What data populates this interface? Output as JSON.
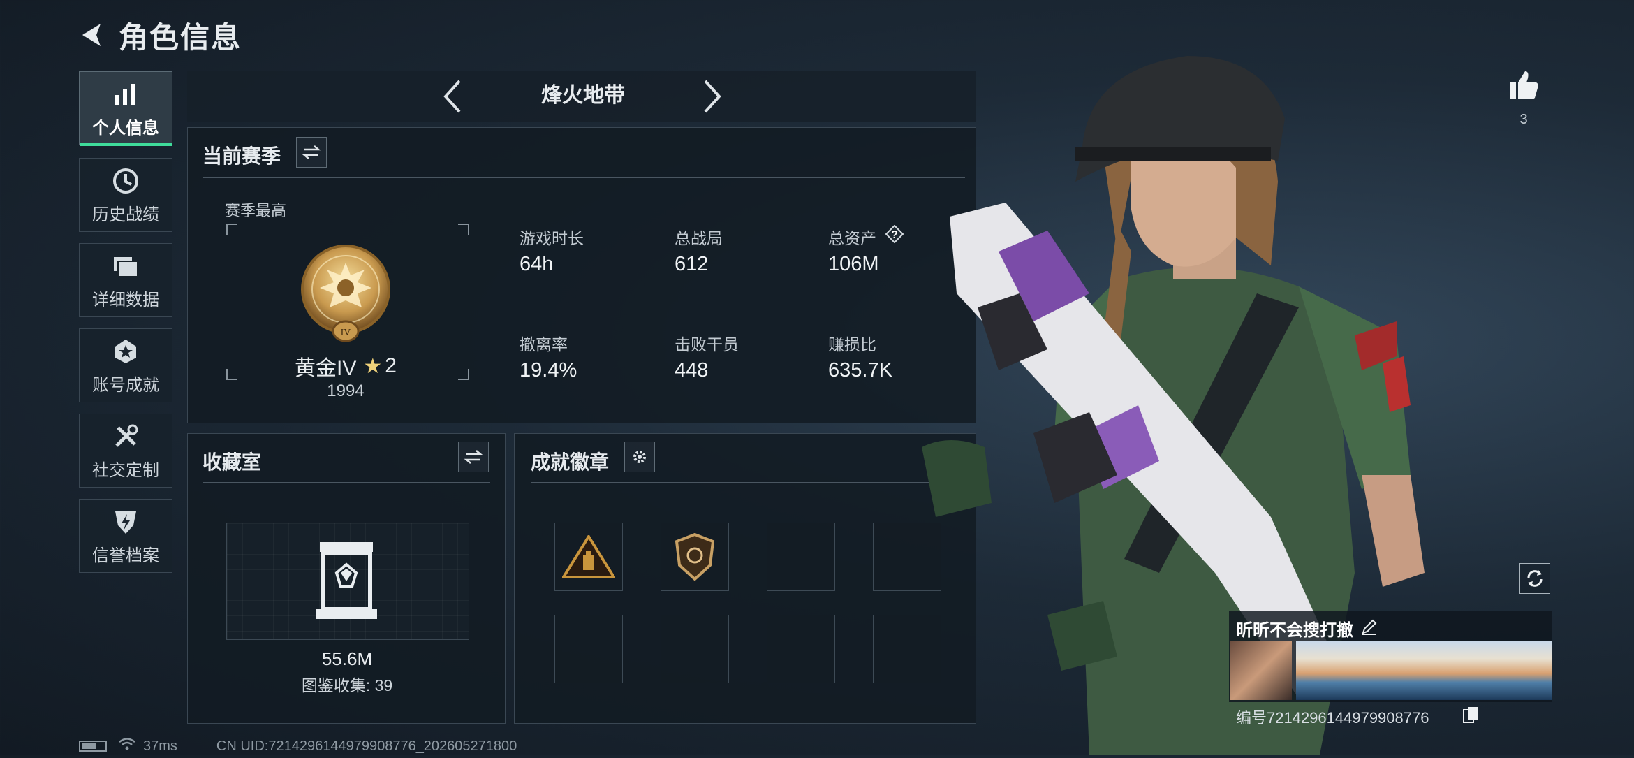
{
  "header": {
    "title": "角色信息"
  },
  "sidebar": {
    "items": [
      {
        "label": "个人信息",
        "icon": "bar-chart-icon",
        "active": true
      },
      {
        "label": "历史战绩",
        "icon": "clock-icon"
      },
      {
        "label": "详细数据",
        "icon": "folder-stack-icon"
      },
      {
        "label": "账号成就",
        "icon": "badge-star-icon"
      },
      {
        "label": "社交定制",
        "icon": "tools-icon"
      },
      {
        "label": "信誉档案",
        "icon": "shield-lightning-icon"
      }
    ]
  },
  "mode": {
    "title": "烽火地带"
  },
  "season": {
    "title": "当前赛季",
    "highest_label": "赛季最高",
    "rank_name": "黄金IV",
    "rank_stars": "2",
    "rank_score": "1994",
    "stats": [
      {
        "label": "游戏时长",
        "value": "64h"
      },
      {
        "label": "总战局",
        "value": "612"
      },
      {
        "label": "总资产",
        "value": "106M",
        "has_help": true
      },
      {
        "label": "撤离率",
        "value": "19.4%"
      },
      {
        "label": "击败干员",
        "value": "448"
      },
      {
        "label": "赚损比",
        "value": "635.7K"
      }
    ]
  },
  "collection": {
    "title": "收藏室",
    "value": "55.6M",
    "catalog_text": "图鉴收集: 39"
  },
  "achievements": {
    "title": "成就徽章"
  },
  "player": {
    "likes": "3",
    "name": "昕昕不会搜打撤",
    "uid_text": "编号7214296144979908776"
  },
  "status": {
    "ping": "37ms",
    "cn_uid": "CN UID:7214296144979908776_202605271800"
  },
  "colors": {
    "accent": "#3fdc9b",
    "gold": "#c9a255"
  }
}
